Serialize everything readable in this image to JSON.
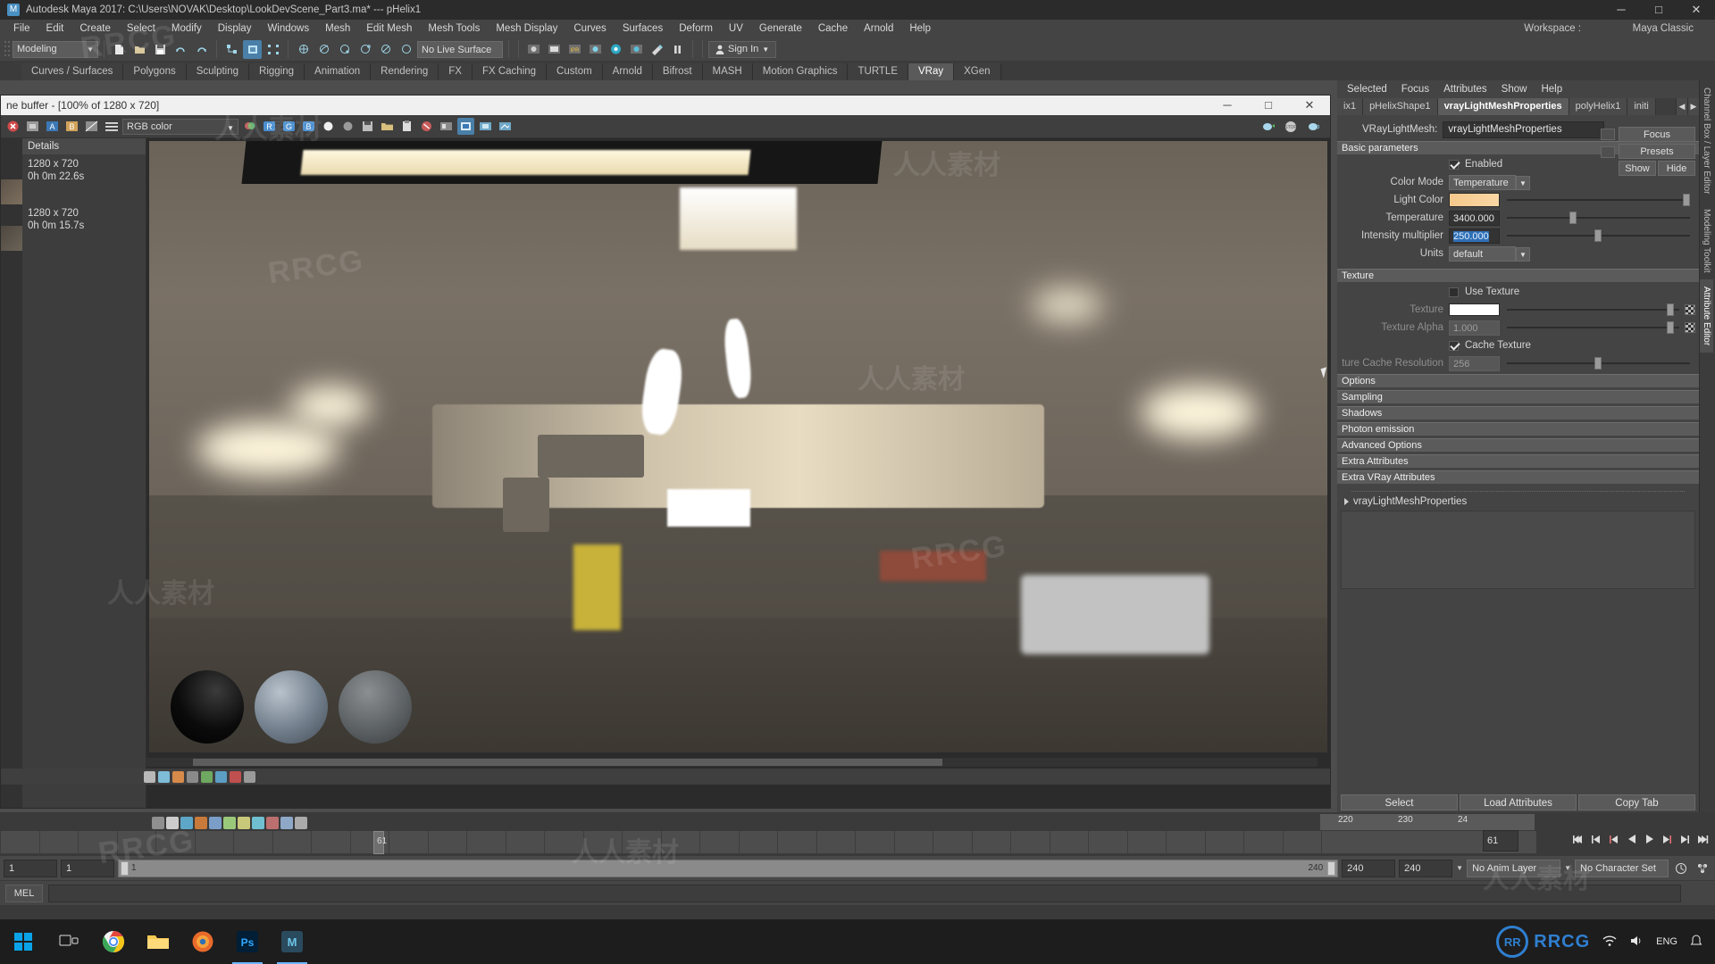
{
  "window": {
    "app_icon": "maya-icon",
    "title": "Autodesk Maya 2017: C:\\Users\\NOVAK\\Desktop\\LookDevScene_Part3.ma*  ---  pHelix1",
    "minimize": "─",
    "maximize": "□",
    "close": "✕"
  },
  "menubar": {
    "items": [
      "File",
      "Edit",
      "Create",
      "Select",
      "Modify",
      "Display",
      "Windows",
      "Mesh",
      "Edit Mesh",
      "Mesh Tools",
      "Mesh Display",
      "Curves",
      "Surfaces",
      "Deform",
      "UV",
      "Generate",
      "Cache",
      "Arnold",
      "Help"
    ],
    "workspace_label": "Workspace :",
    "workspace_value": "Maya Classic"
  },
  "statusbar": {
    "menuset": "Modeling",
    "menuset_arrow": "▼",
    "live_surface": "No Live Surface",
    "signin": "Sign In",
    "signin_icon": "person-icon",
    "icons": [
      "new-scene-icon",
      "open-scene-icon",
      "save-scene-icon",
      "undo-icon",
      "redo-icon",
      "select-by-hierarchy-icon",
      "select-by-object-icon",
      "select-by-component-icon",
      "snap-grid-icon",
      "snap-curve-icon",
      "snap-point-icon",
      "snap-projected-icon",
      "snap-view-icon",
      "snap-orthogonal-icon",
      "render-current-frame-icon",
      "ipr-render-icon",
      "render-settings-icon",
      "hypershade-icon",
      "render-view-icon",
      "light-editor-icon",
      "pause-icon",
      "open-editor-icon"
    ]
  },
  "shelf": {
    "tabs": [
      "Curves / Surfaces",
      "Polygons",
      "Sculpting",
      "Rigging",
      "Animation",
      "Rendering",
      "FX",
      "FX Caching",
      "Custom",
      "Arnold",
      "Bifrost",
      "MASH",
      "Motion Graphics",
      "TURTLE",
      "VRay",
      "XGen"
    ],
    "active": "VRay"
  },
  "render_view": {
    "title": "ne buffer - [100% of 1280 x 720]",
    "minimize": "─",
    "maximize": "□",
    "close": "✕",
    "channel_mode": "RGB color",
    "channel_arrow": "▼",
    "toolbar_icons": [
      "render-abort-icon",
      "region-render-icon",
      "channel-a-icon",
      "channel-b-icon",
      "menu-lines-icon",
      "color-corrections-icon",
      "red-channel-icon",
      "green-channel-icon",
      "blue-channel-icon",
      "alpha-channel-icon",
      "monochrome-icon",
      "save-image-icon",
      "load-image-icon",
      "clipboard-icon",
      "stamp-icon",
      "pixel-aspect-icon",
      "track-icon",
      "region-icon",
      "light-cache-icon"
    ],
    "right_icons": [
      "render-teapot-icon",
      "stop-render-icon",
      "ipr-teapot-icon"
    ],
    "details": {
      "header": "Details",
      "entries": [
        {
          "resolution": "1280 x 720",
          "time": "0h 0m 22.6s"
        },
        {
          "resolution": "1280 x 720",
          "time": "0h 0m 15.7s"
        }
      ]
    }
  },
  "attribute_editor": {
    "menu": [
      "Selected",
      "Focus",
      "Attributes",
      "Show",
      "Help"
    ],
    "tabs": [
      "ix1",
      "pHelixShape1",
      "vrayLightMeshProperties",
      "polyHelix1",
      "initi"
    ],
    "active_tab": "vrayLightMeshProperties",
    "tab_prev": "◀",
    "tab_next": "▶",
    "node_label": "VRayLightMesh:",
    "node_value": "vrayLightMeshProperties",
    "side_buttons": [
      "Focus",
      "Presets"
    ],
    "show_button": "Show",
    "hide_button": "Hide",
    "basic_parameters": {
      "title": "Basic parameters",
      "enabled_label": "Enabled",
      "enabled_checked": true,
      "color_mode_label": "Color Mode",
      "color_mode_value": "Temperature",
      "light_color_label": "Light Color",
      "light_color_hex": "#f7cd94",
      "light_color_slider_pct": 96,
      "temperature_label": "Temperature",
      "temperature_value": "3400.000",
      "temperature_slider_pct": 34,
      "intensity_label": "Intensity multiplier",
      "intensity_value": "250.000",
      "intensity_selected": true,
      "intensity_slider_pct": 48,
      "units_label": "Units",
      "units_value": "default"
    },
    "texture": {
      "title": "Texture",
      "use_texture_label": "Use Texture",
      "use_texture_checked": false,
      "texture_label": "Texture",
      "texture_color_hex": "#ffffff",
      "texture_slider_pct": 94,
      "texture_alpha_label": "Texture Alpha",
      "texture_alpha_value": "1.000",
      "texture_alpha_slider_pct": 94,
      "cache_texture_label": "Cache Texture",
      "cache_texture_checked": true,
      "cache_resolution_label": "ture Cache Resolution",
      "cache_resolution_value": "256",
      "cache_resolution_slider_pct": 48
    },
    "collapsed_sections": [
      "Options",
      "Sampling",
      "Shadows",
      "Photon emission",
      "Advanced Options",
      "Extra Attributes",
      "Extra VRay Attributes"
    ],
    "node_footer_name": "vrayLightMeshProperties",
    "footer_buttons": [
      "Select",
      "Load Attributes",
      "Copy Tab"
    ]
  },
  "right_vtabs": [
    "Channel Box / Layer Editor",
    "Modeling Toolkit",
    "Attribute Editor"
  ],
  "timeline": {
    "current_frame_marker": "61",
    "current_frame_field": "61",
    "tick_labels": [
      "220",
      "230",
      "24"
    ],
    "transport_icons": [
      "go-to-start-icon",
      "step-back-key-icon",
      "step-back-frame-icon",
      "play-backwards-icon",
      "play-forwards-icon",
      "step-forward-frame-icon",
      "step-forward-key-icon",
      "go-to-end-icon"
    ]
  },
  "range": {
    "start_field": "1",
    "end_field": "1",
    "slider_start": "1",
    "slider_end": "240",
    "playback_end": "240",
    "anim_end": "240",
    "anim_layer": "No Anim Layer",
    "character_set": "No Character Set",
    "arrow": "▼",
    "right_icons": [
      "anim-preferences-icon",
      "character-set-icon"
    ]
  },
  "command_line": {
    "label": "MEL",
    "input_value": "",
    "help_icon": "help-icon"
  },
  "taskbar": {
    "start_icon": "windows-logo-icon",
    "apps": [
      "task-view-icon",
      "chrome-icon",
      "file-explorer-icon",
      "firefox-icon",
      "photoshop-icon",
      "maya-icon"
    ],
    "tray": {
      "network_icon": "network-icon",
      "volume_icon": "volume-icon",
      "language": "ENG"
    },
    "branding": {
      "logo_text": "RR",
      "brand_text": "RRCG"
    }
  },
  "watermarks": {
    "rrcg": "RRCG",
    "chinese": "人人素材"
  }
}
